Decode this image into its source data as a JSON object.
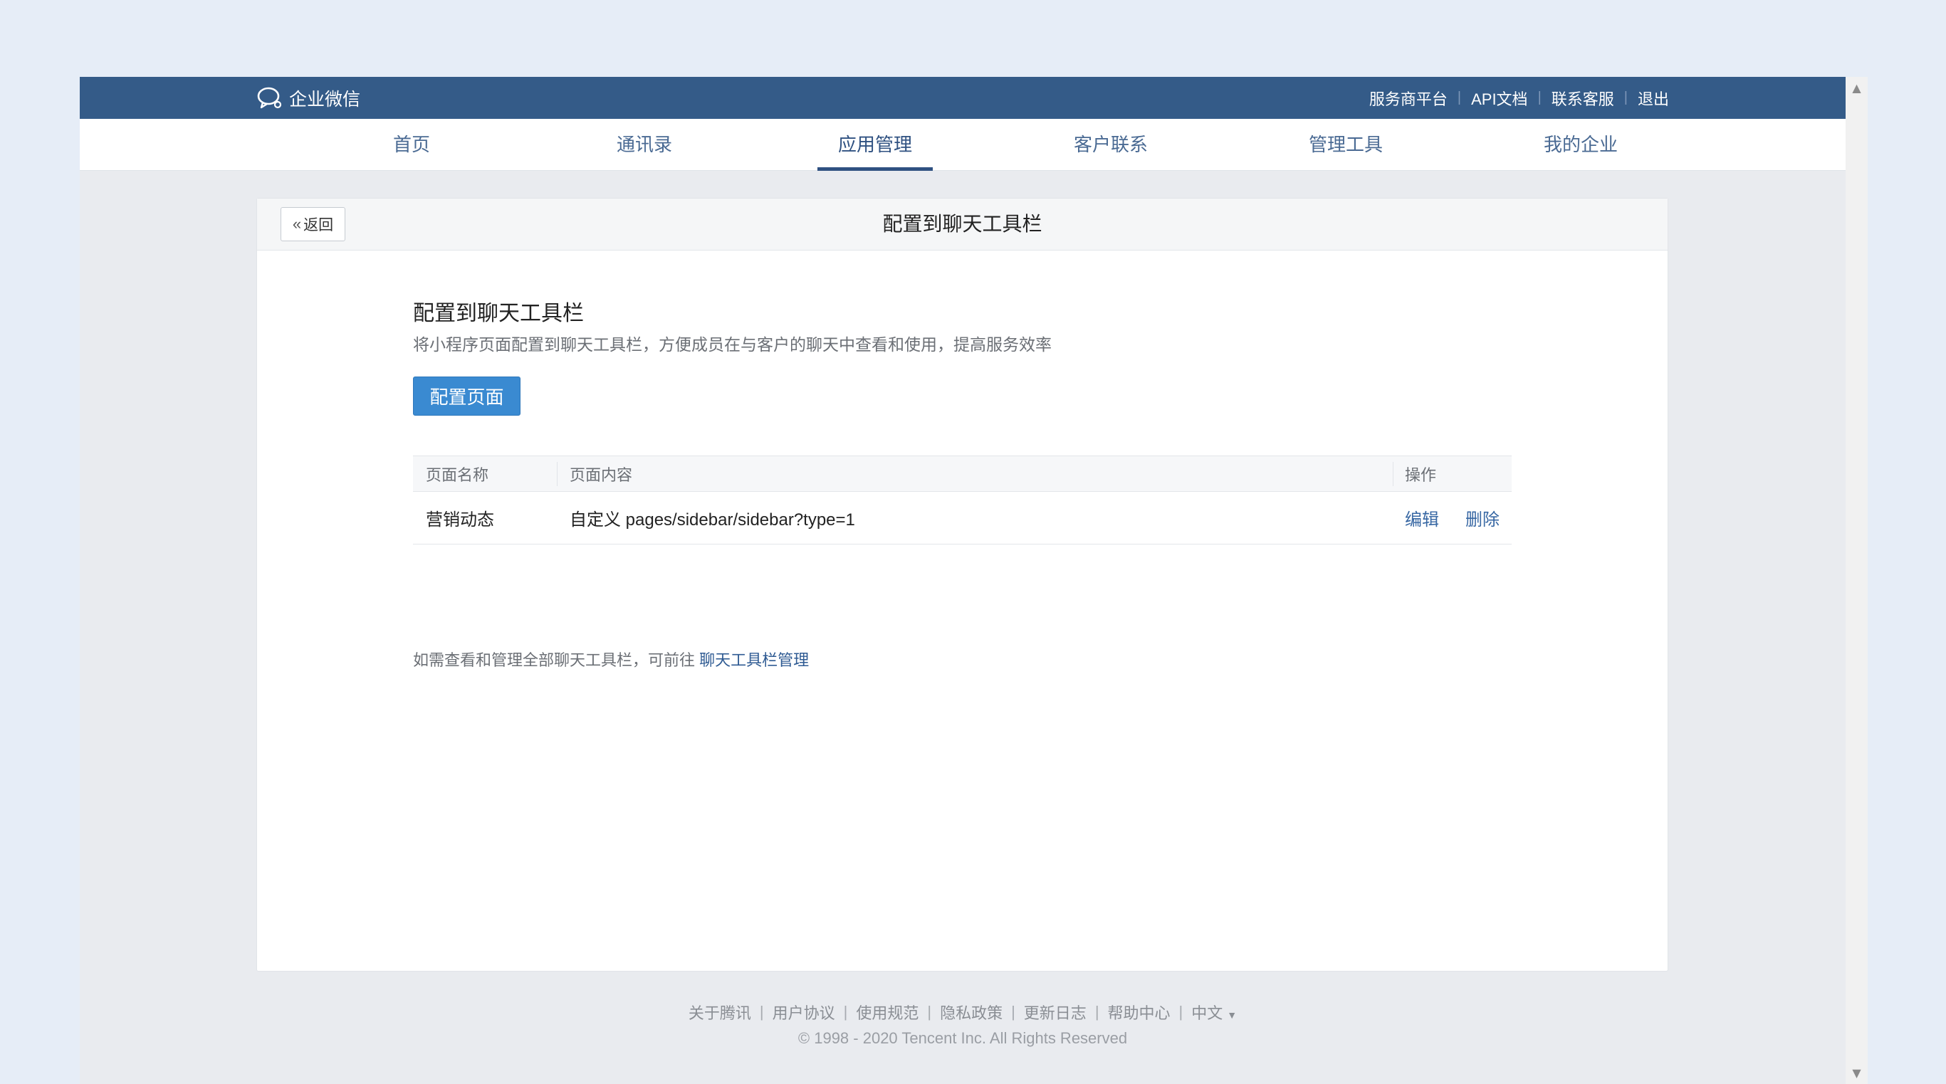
{
  "header": {
    "logo_text": "企业微信",
    "links": [
      "服务商平台",
      "API文档",
      "联系客服",
      "退出"
    ]
  },
  "nav": {
    "items": [
      "首页",
      "通讯录",
      "应用管理",
      "客户联系",
      "管理工具",
      "我的企业"
    ],
    "active": "应用管理"
  },
  "card": {
    "back_label": "返回",
    "title": "配置到聊天工具栏"
  },
  "section": {
    "title": "配置到聊天工具栏",
    "description": "将小程序页面配置到聊天工具栏，方便成员在与客户的聊天中查看和使用，提高服务效率",
    "config_button": "配置页面"
  },
  "table": {
    "headers": [
      "页面名称",
      "页面内容",
      "操作"
    ],
    "rows": [
      {
        "name": "营销动态",
        "content": "自定义 pages/sidebar/sidebar?type=1",
        "actions": [
          "编辑",
          "删除"
        ]
      }
    ]
  },
  "footnote": {
    "text": "如需查看和管理全部聊天工具栏，可前往 ",
    "link": "聊天工具栏管理"
  },
  "footer": {
    "links": [
      "关于腾讯",
      "用户协议",
      "使用规范",
      "隐私政策",
      "更新日志",
      "帮助中心",
      "中文"
    ],
    "copyright": "© 1998 - 2020 Tencent Inc. All Rights Reserved"
  },
  "colors": {
    "topbar": "#345b88",
    "primary_button": "#3a8ad1",
    "link": "#3767a3"
  }
}
